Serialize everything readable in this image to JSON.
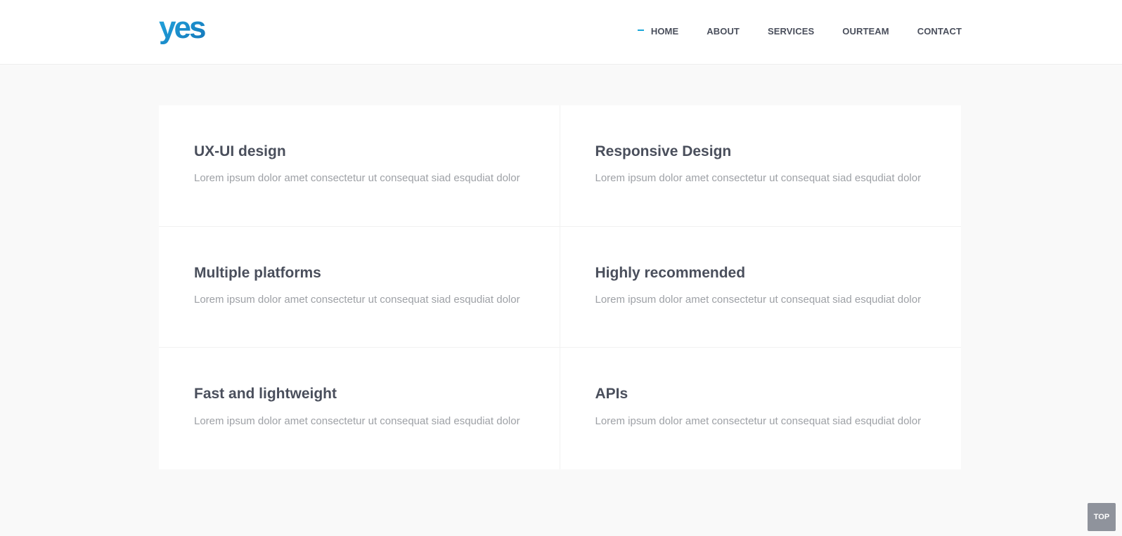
{
  "header": {
    "logo_text": "yes",
    "nav": [
      {
        "label": "HOME",
        "active": true
      },
      {
        "label": "ABOUT"
      },
      {
        "label": "SERVICES"
      },
      {
        "label": "OURTEAM"
      },
      {
        "label": "CONTACT"
      }
    ]
  },
  "features": [
    {
      "title": "UX-UI design",
      "text": "Lorem ipsum dolor amet consectetur ut consequat siad esqudiat dolor"
    },
    {
      "title": "Responsive Design",
      "text": "Lorem ipsum dolor amet consectetur ut consequat siad esqudiat dolor"
    },
    {
      "title": "Multiple platforms",
      "text": "Lorem ipsum dolor amet consectetur ut consequat siad esqudiat dolor"
    },
    {
      "title": "Highly recommended",
      "text": "Lorem ipsum dolor amet consectetur ut consequat siad esqudiat dolor"
    },
    {
      "title": "Fast and lightweight",
      "text": "Lorem ipsum dolor amet consectetur ut consequat siad esqudiat dolor"
    },
    {
      "title": "APIs",
      "text": "Lorem ipsum dolor amet consectetur ut consequat siad esqudiat dolor"
    }
  ],
  "top_button": {
    "label": "TOP"
  },
  "colors": {
    "accent": "#1aa7d9",
    "logo_light": "#23a9e1",
    "logo_dark": "#1475b8",
    "heading": "#4a4f5c",
    "body_text": "#9ea1a6",
    "page_background": "#f9f9f9"
  }
}
